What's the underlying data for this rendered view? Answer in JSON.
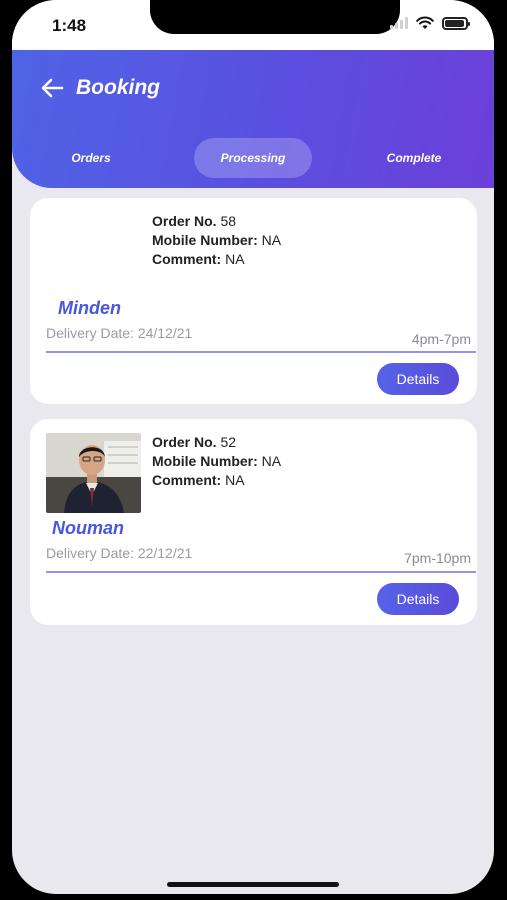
{
  "status_bar": {
    "time": "1:48"
  },
  "header": {
    "title": "Booking"
  },
  "tabs": [
    {
      "label": "Orders",
      "active": false
    },
    {
      "label": "Processing",
      "active": true
    },
    {
      "label": "Complete",
      "active": false
    }
  ],
  "bookings": [
    {
      "order_label": "Order No.",
      "order_no": "58",
      "mobile_label": "Mobile Number:",
      "mobile": "NA",
      "comment_label": "Comment:",
      "comment": "NA",
      "name": "Minden",
      "delivery_label": "Delivery Date:",
      "delivery_date": "24/12/21",
      "time_slot": "4pm-7pm",
      "details_label": "Details",
      "has_photo": false
    },
    {
      "order_label": "Order No.",
      "order_no": "52",
      "mobile_label": "Mobile Number:",
      "mobile": "NA",
      "comment_label": "Comment:",
      "comment": "NA",
      "name": "Nouman",
      "delivery_label": "Delivery Date:",
      "delivery_date": "22/12/21",
      "time_slot": "7pm-10pm",
      "details_label": "Details",
      "has_photo": true
    }
  ],
  "colors": {
    "header_gradient_start": "#4f63e6",
    "header_gradient_end": "#6c3fd9",
    "accent": "#4a55e0",
    "background": "#e9e8ef"
  }
}
